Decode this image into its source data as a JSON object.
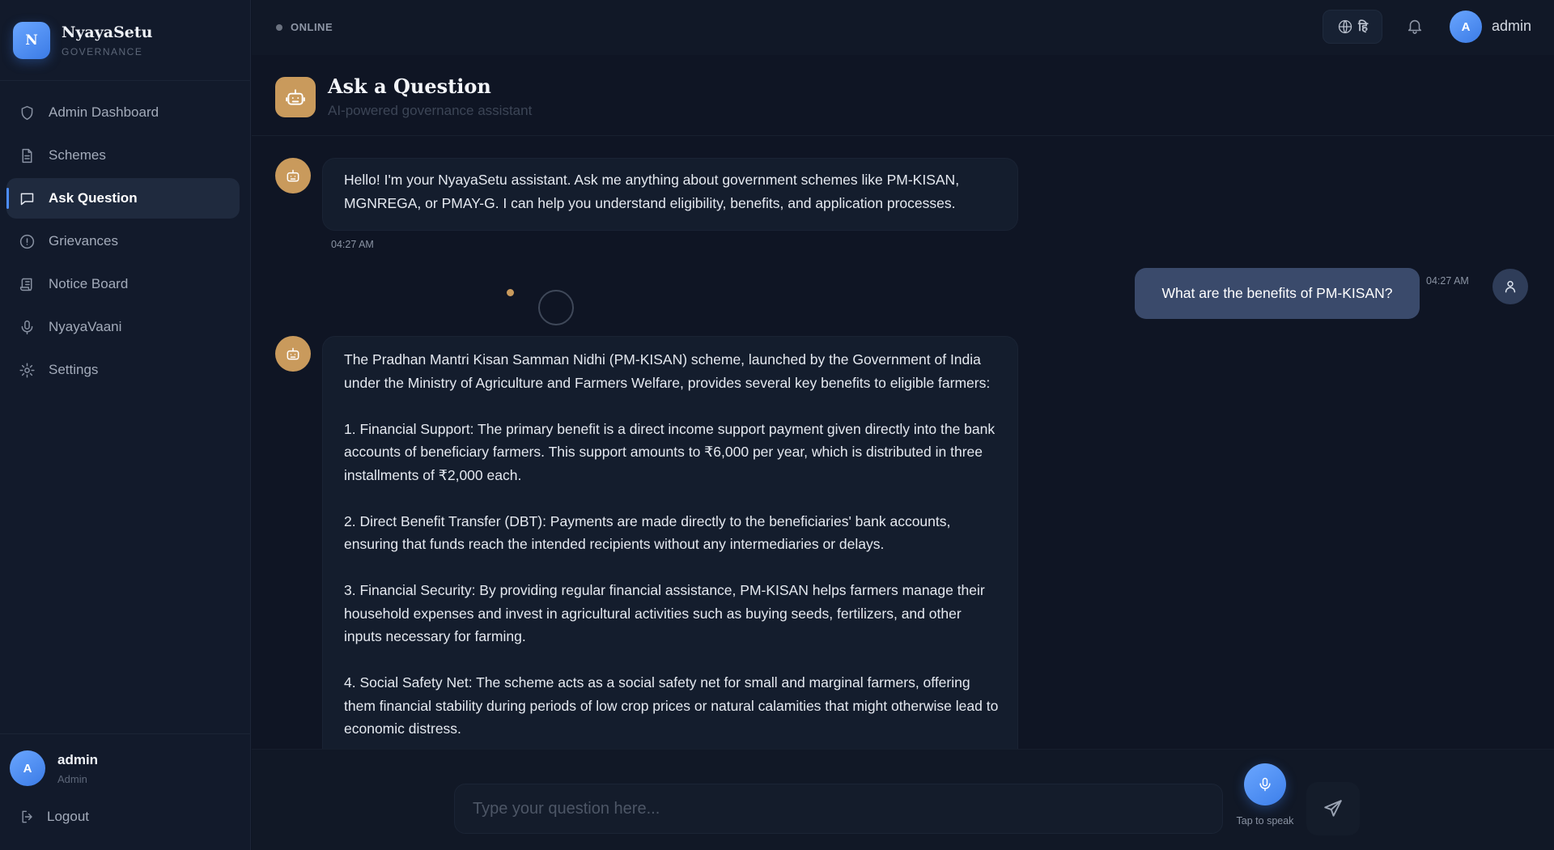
{
  "brand": {
    "logo_letter": "N",
    "name": "NyayaSetu",
    "subtitle": "GOVERNANCE"
  },
  "sidebar": {
    "items": [
      {
        "label": "Admin Dashboard",
        "icon": "shield-icon",
        "active": false
      },
      {
        "label": "Schemes",
        "icon": "document-icon",
        "active": false
      },
      {
        "label": "Ask Question",
        "icon": "chat-bubble-icon",
        "active": true
      },
      {
        "label": "Grievances",
        "icon": "alert-circle-icon",
        "active": false
      },
      {
        "label": "Notice Board",
        "icon": "scroll-icon",
        "active": false
      },
      {
        "label": "NyayaVaani",
        "icon": "microphone-icon",
        "active": false
      },
      {
        "label": "Settings",
        "icon": "gear-icon",
        "active": false
      }
    ],
    "user": {
      "avatar_letter": "A",
      "name": "admin",
      "role": "Admin"
    },
    "logout_label": "Logout"
  },
  "topbar": {
    "status": "ONLINE",
    "language_glyph": "हि",
    "user": {
      "avatar_letter": "A",
      "name": "admin"
    }
  },
  "header": {
    "title": "Ask a Question",
    "subtitle": "AI-powered governance assistant"
  },
  "chat": {
    "messages": [
      {
        "role": "assistant",
        "text": "Hello! I'm your NyayaSetu assistant. Ask me anything about government schemes like PM-KISAN, MGNREGA, or PMAY-G. I can help you understand eligibility, benefits, and application processes.",
        "time": "04:27 AM"
      },
      {
        "role": "user",
        "text": "What are the benefits of PM-KISAN?",
        "time": "04:27 AM"
      },
      {
        "role": "assistant",
        "paragraphs": [
          "The Pradhan Mantri Kisan Samman Nidhi (PM-KISAN) scheme, launched by the Government of India under the Ministry of Agriculture and Farmers Welfare, provides several key benefits to eligible farmers:",
          "1. Financial Support: The primary benefit is a direct income support payment given directly into the bank accounts of beneficiary farmers. This support amounts to ₹6,000 per year, which is distributed in three installments of ₹2,000 each.",
          "2. Direct Benefit Transfer (DBT): Payments are made directly to the beneficiaries' bank accounts, ensuring that funds reach the intended recipients without any intermediaries or delays.",
          "3. Financial Security: By providing regular financial assistance, PM-KISAN helps farmers manage their household expenses and invest in agricultural activities such as buying seeds, fertilizers, and other inputs necessary for farming.",
          "4. Social Safety Net: The scheme acts as a social safety net for small and marginal farmers, offering them financial stability during periods of low crop prices or natural calamities that might otherwise lead to economic distress."
        ]
      }
    ]
  },
  "composer": {
    "placeholder": "Type your question here...",
    "value": "",
    "mic_label": "Tap to speak"
  },
  "colors": {
    "accent": "#4c8dff",
    "bot_avatar": "#c99a5c",
    "user_bubble": "#3a4a6b",
    "background": "#0f1524"
  }
}
